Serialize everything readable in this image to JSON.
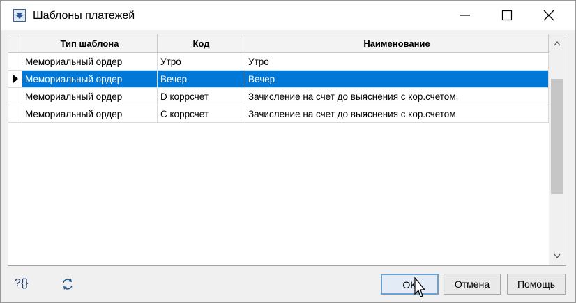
{
  "window": {
    "title": "Шаблоны платежей"
  },
  "grid": {
    "columns": [
      "Тип шаблона",
      "Код",
      "Наименование"
    ],
    "rows": [
      [
        "Мемориальный ордер",
        "Утро",
        "Утро"
      ],
      [
        "Мемориальный ордер",
        "Вечер",
        "Вечер"
      ],
      [
        "Мемориальный ордер",
        "D коррсчет",
        "Зачисление на счет до выяснения с кор.счетом."
      ],
      [
        "Мемориальный ордер",
        "С коррсчет",
        "Зачисление на счет до выяснения с кор.счетом"
      ]
    ],
    "selected_row": 1
  },
  "toolbar": {
    "query_icon_label": "?{}",
    "refresh_icon": "refresh-icon"
  },
  "buttons": {
    "ok": "OK",
    "cancel": "Отмена",
    "help": "Помощь"
  },
  "colors": {
    "selection": "#0078d7",
    "selection_text": "#ffffff"
  }
}
